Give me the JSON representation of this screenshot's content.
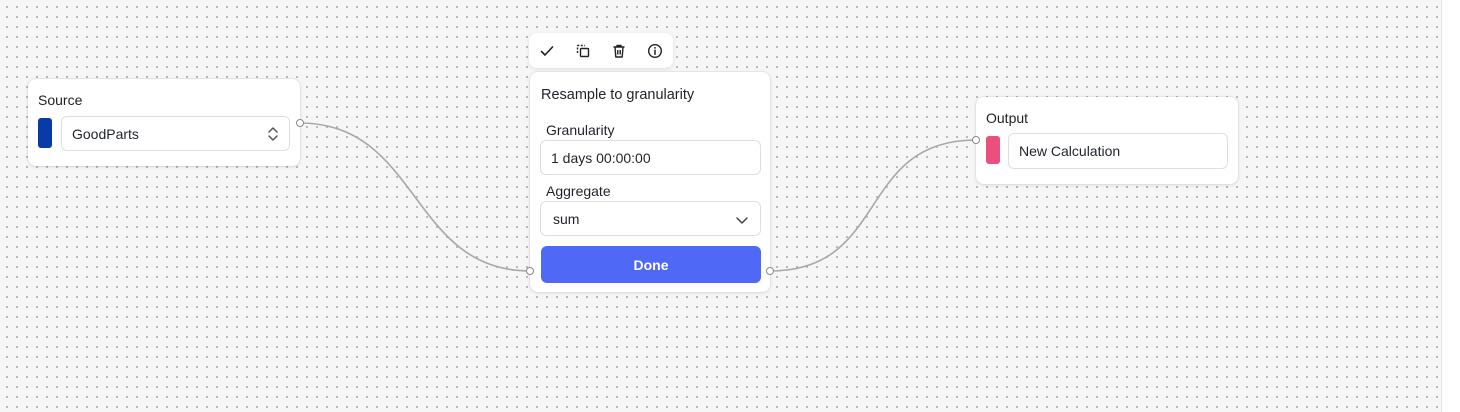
{
  "colors": {
    "source_swatch": "#0a3aa8",
    "output_swatch": "#e9507e",
    "done_button": "#4f68f5",
    "edge": "#a8a8a8"
  },
  "toolbar": {
    "icons": [
      "check-icon",
      "duplicate-icon",
      "trash-icon",
      "info-icon"
    ]
  },
  "source_node": {
    "title": "Source",
    "select_value": "GoodParts"
  },
  "resample_node": {
    "title": "Resample to granularity",
    "granularity_label": "Granularity",
    "granularity_value": "1 days 00:00:00",
    "aggregate_label": "Aggregate",
    "aggregate_value": "sum",
    "done_label": "Done"
  },
  "output_node": {
    "title": "Output",
    "input_value": "New Calculation"
  }
}
